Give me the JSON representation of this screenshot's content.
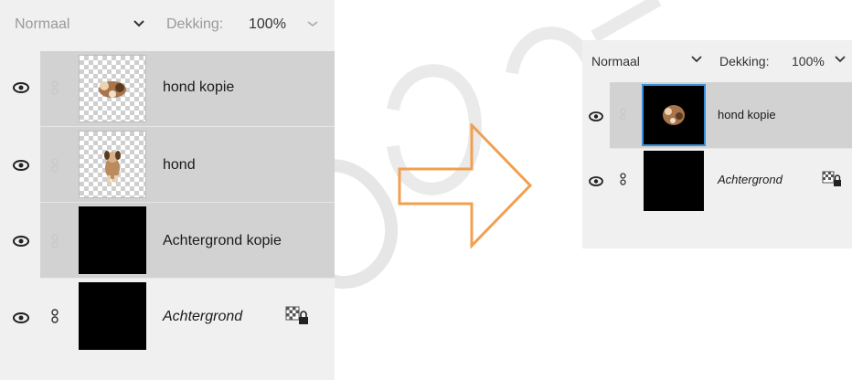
{
  "left_panel": {
    "blend_mode": "Normaal",
    "opacity_label": "Dekking:",
    "opacity_value": "100%",
    "layers": [
      {
        "name": "hond kopie",
        "selected": true,
        "thumbnail": "dog-group-icon"
      },
      {
        "name": "hond",
        "selected": true,
        "thumbnail": "dog-icon"
      },
      {
        "name": "Achtergrond kopie",
        "selected": true,
        "thumbnail": "black-fill"
      },
      {
        "name": "Achtergrond",
        "selected": false,
        "thumbnail": "black-fill"
      }
    ]
  },
  "right_panel": {
    "blend_mode": "Normaal",
    "opacity_label": "Dekking:",
    "opacity_value": "100%",
    "layers": [
      {
        "name": "hond kopie",
        "selected": true,
        "thumbnail": "dog-on-black-icon"
      },
      {
        "name": "Achtergrond",
        "selected": false,
        "thumbnail": "black-fill"
      }
    ]
  },
  "colors": {
    "arrow": "#f0a050",
    "watermark": "#dcdcdc",
    "selected_row": "#d2d2d2",
    "panel_bg": "#f0f0f0"
  },
  "icons": {
    "visibility": "eye-icon",
    "link": "link-icon",
    "lock": "transparency-lock-icon",
    "dropdown": "chevron-down-icon",
    "transform": "right-arrow-icon"
  }
}
